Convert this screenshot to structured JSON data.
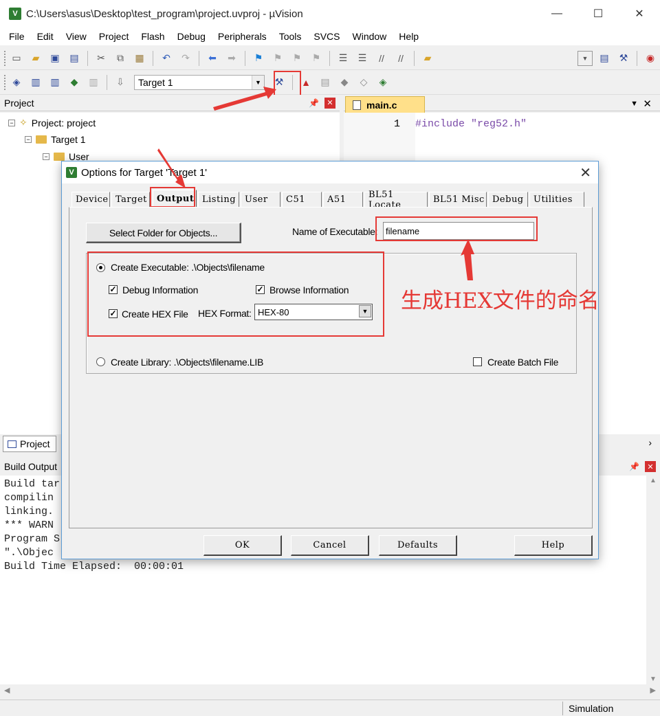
{
  "window": {
    "title": "C:\\Users\\asus\\Desktop\\test_program\\project.uvproj - µVision",
    "app_icon_letter": "V",
    "minimize": "—",
    "maximize": "☐",
    "close": "✕"
  },
  "menu": [
    "File",
    "Edit",
    "View",
    "Project",
    "Flash",
    "Debug",
    "Peripherals",
    "Tools",
    "SVCS",
    "Window",
    "Help"
  ],
  "toolbar2": {
    "target_label": "Target 1"
  },
  "project_panel": {
    "title": "Project",
    "tree": {
      "project": "Project: project",
      "target": "Target 1",
      "group": "User"
    }
  },
  "editor": {
    "tab": "main.c",
    "line_no": "1",
    "code_line": "#include \"reg52.h\""
  },
  "bottom_tab": "Project",
  "build_output": {
    "title": "Build Output",
    "lines": [
      "Build tar",
      "compilin",
      "linking.",
      "*** WARN",
      "Program S",
      "\".\\Objec",
      "Build Time Elapsed:  00:00:01"
    ]
  },
  "status": {
    "mode": "Simulation"
  },
  "dialog": {
    "title": "Options for Target 'Target 1'",
    "tabs": [
      "Device",
      "Target",
      "Output",
      "Listing",
      "User",
      "C51",
      "A51",
      "BL51 Locate",
      "BL51 Misc",
      "Debug",
      "Utilities"
    ],
    "active_tab": "Output",
    "select_folder_button": "Select Folder for Objects...",
    "name_label": "Name of Executable:",
    "name_value": "filename",
    "create_executable": {
      "label": "Create Executable:  .\\Objects\\filename",
      "selected": true
    },
    "debug_info": {
      "label": "Debug Information",
      "checked": true
    },
    "browse_info": {
      "label": "Browse Information",
      "checked": true
    },
    "create_hex": {
      "label": "Create HEX File",
      "checked": true
    },
    "hex_format_label": "HEX Format:",
    "hex_format_value": "HEX-80",
    "create_library": {
      "label": "Create Library:  .\\Objects\\filename.LIB",
      "selected": false
    },
    "batch_file": {
      "label": "Create Batch File",
      "checked": false
    },
    "buttons": {
      "ok": "OK",
      "cancel": "Cancel",
      "defaults": "Defaults",
      "help": "Help"
    }
  },
  "annotation": {
    "text": "生成HEX文件的命名",
    "color": "#e53935"
  },
  "colors": {
    "accent_red": "#e53935",
    "editor_tab": "#ffe08a",
    "dialog_border": "#5b9bd5"
  }
}
